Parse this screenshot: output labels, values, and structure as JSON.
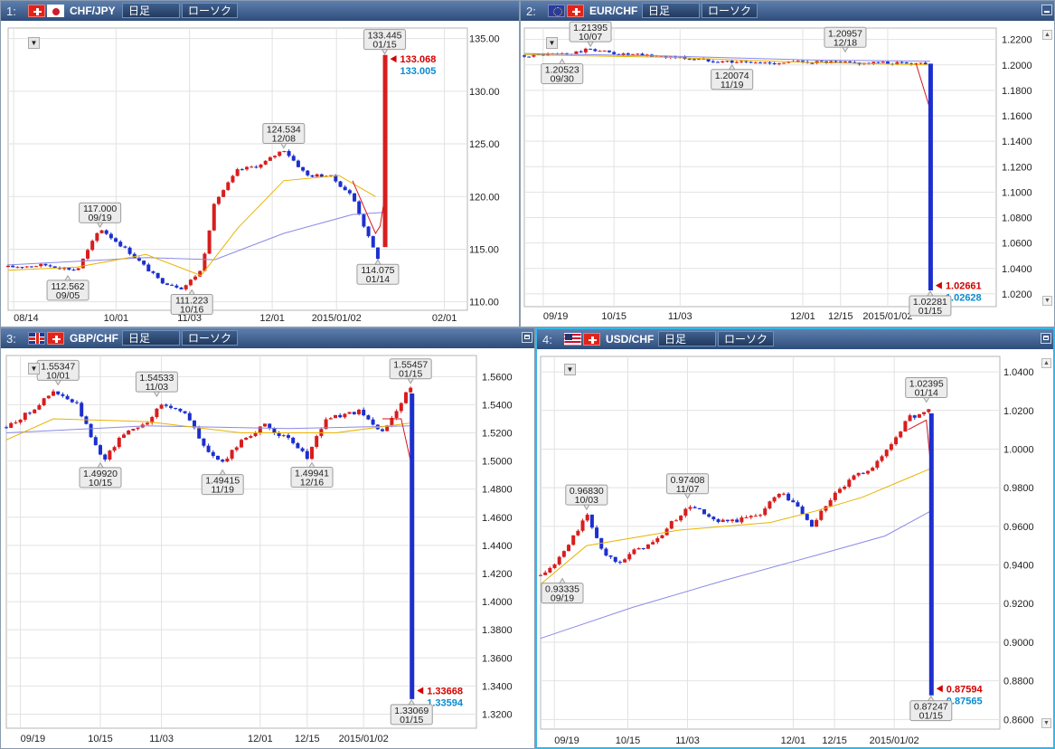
{
  "panels": [
    {
      "num": "1:",
      "symbol": "CHF/JPY",
      "flags": [
        "flag-ch",
        "flag-jp"
      ],
      "timeframe": "日足",
      "chart_style": "ローソク",
      "dropdown": "▼",
      "chart_data": {
        "type": "candlestick",
        "ylim": [
          109.2,
          136.0
        ],
        "yticks": [
          "135.00",
          "130.00",
          "125.00",
          "120.00",
          "115.00",
          "110.00"
        ],
        "ytick_values": [
          135,
          130,
          125,
          120,
          115,
          110
        ],
        "xticks": [
          "08/14",
          "10/01",
          "11/03",
          "12/01",
          "2015/01/02",
          "02/01"
        ],
        "xtick_pos": [
          0.012,
          0.235,
          0.395,
          0.575,
          0.715,
          0.95
        ],
        "last_index": 0.82,
        "anchors": [
          [
            0,
            113.3
          ],
          [
            0.08,
            113.5
          ],
          [
            0.15,
            113.0
          ],
          [
            0.2,
            117.0
          ],
          [
            0.27,
            114.5
          ],
          [
            0.33,
            112.0
          ],
          [
            0.38,
            111.3
          ],
          [
            0.42,
            113.0
          ],
          [
            0.45,
            119.5
          ],
          [
            0.5,
            122.5
          ],
          [
            0.55,
            123.0
          ],
          [
            0.6,
            124.5
          ],
          [
            0.65,
            122.0
          ],
          [
            0.7,
            122.0
          ],
          [
            0.75,
            120.0
          ],
          [
            0.79,
            115.5
          ],
          [
            0.805,
            114.2
          ]
        ],
        "spike": {
          "from": 115.2,
          "to": 133.445,
          "close": 133.068,
          "color": "#d71e1e"
        },
        "ma_short": [
          [
            0.75,
            121.5
          ],
          [
            0.79,
            117.5
          ],
          [
            0.8,
            116.5
          ],
          [
            0.81,
            117.2
          ],
          [
            0.82,
            120
          ]
        ],
        "ma_mid": [
          [
            0,
            113
          ],
          [
            0.15,
            113.3
          ],
          [
            0.3,
            114.5
          ],
          [
            0.42,
            112.5
          ],
          [
            0.5,
            117
          ],
          [
            0.6,
            121.5
          ],
          [
            0.72,
            122
          ],
          [
            0.8,
            120
          ]
        ],
        "ma_long": [
          [
            0,
            113.5
          ],
          [
            0.3,
            114.2
          ],
          [
            0.45,
            114
          ],
          [
            0.6,
            116.5
          ],
          [
            0.75,
            118.3
          ],
          [
            0.82,
            118.5
          ]
        ],
        "bid": "133.068",
        "ask": "133.005",
        "annotations": [
          {
            "value": "117.000",
            "date": "09/19",
            "x": 0.2,
            "y": 117.0,
            "pos": "above"
          },
          {
            "value": "112.562",
            "date": "09/05",
            "x": 0.13,
            "y": 112.56,
            "pos": "below"
          },
          {
            "value": "111.223",
            "date": "10/16",
            "x": 0.4,
            "y": 111.22,
            "pos": "below"
          },
          {
            "value": "124.534",
            "date": "12/08",
            "x": 0.6,
            "y": 124.53,
            "pos": "above"
          },
          {
            "value": "114.075",
            "date": "01/14",
            "x": 0.805,
            "y": 114.08,
            "pos": "below"
          },
          {
            "value": "133.445",
            "date": "01/15",
            "x": 0.82,
            "y": 133.45,
            "pos": "above"
          }
        ]
      }
    },
    {
      "num": "2:",
      "symbol": "EUR/CHF",
      "flags": [
        "flag-eu",
        "flag-ch"
      ],
      "timeframe": "日足",
      "chart_style": "ローソク",
      "dropdown": "▼",
      "chart_data": {
        "type": "candlestick",
        "ylim": [
          1.01,
          1.229
        ],
        "yticks": [
          "1.2200",
          "1.2000",
          "1.1800",
          "1.1600",
          "1.1400",
          "1.1200",
          "1.1000",
          "1.0800",
          "1.0600",
          "1.0400",
          "1.0200"
        ],
        "ytick_values": [
          1.22,
          1.2,
          1.18,
          1.16,
          1.14,
          1.12,
          1.1,
          1.08,
          1.06,
          1.04,
          1.02
        ],
        "xticks": [
          "09/19",
          "10/15",
          "11/03",
          "12/01",
          "12/15",
          "2015/01/02"
        ],
        "xtick_pos": [
          0.04,
          0.19,
          0.33,
          0.59,
          0.67,
          0.77
        ],
        "last_index": 0.86,
        "anchors": [
          [
            0,
            1.2075
          ],
          [
            0.1,
            1.209
          ],
          [
            0.14,
            1.2125
          ],
          [
            0.2,
            1.2085
          ],
          [
            0.3,
            1.2065
          ],
          [
            0.4,
            1.2035
          ],
          [
            0.5,
            1.2015
          ],
          [
            0.6,
            1.2025
          ],
          [
            0.7,
            1.2015
          ],
          [
            0.8,
            1.2015
          ],
          [
            0.85,
            1.2015
          ]
        ],
        "spike": {
          "from": 1.201,
          "to": 1.02281,
          "close": 1.02661,
          "color": "#1c2fcf"
        },
        "ma_short": [
          [
            0.83,
            1.201
          ],
          [
            0.86,
            1.165
          ]
        ],
        "ma_mid": [
          [
            0,
            1.208
          ],
          [
            0.3,
            1.206
          ],
          [
            0.6,
            1.202
          ],
          [
            0.86,
            1.2
          ]
        ],
        "ma_long": [
          [
            0,
            1.209
          ],
          [
            0.3,
            1.207
          ],
          [
            0.6,
            1.204
          ],
          [
            0.86,
            1.203
          ]
        ],
        "bid": "1.02661",
        "ask": "1.02628",
        "annotations": [
          {
            "value": "1.21395",
            "date": "10/07",
            "x": 0.14,
            "y": 1.21395,
            "pos": "above"
          },
          {
            "value": "1.20523",
            "date": "09/30",
            "x": 0.08,
            "y": 1.2052,
            "pos": "below"
          },
          {
            "value": "1.20074",
            "date": "11/19",
            "x": 0.44,
            "y": 1.2007,
            "pos": "below"
          },
          {
            "value": "1.20957",
            "date": "12/18",
            "x": 0.68,
            "y": 1.2096,
            "pos": "above"
          },
          {
            "value": "1.02281",
            "date": "01/15",
            "x": 0.86,
            "y": 1.0228,
            "pos": "below"
          }
        ]
      }
    },
    {
      "num": "3:",
      "symbol": "GBP/CHF",
      "flags": [
        "flag-gb",
        "flag-ch"
      ],
      "timeframe": "日足",
      "chart_style": "ローソク",
      "dropdown": "▼",
      "chart_data": {
        "type": "candlestick",
        "ylim": [
          1.31,
          1.575
        ],
        "yticks": [
          "1.5600",
          "1.5400",
          "1.5200",
          "1.5000",
          "1.4800",
          "1.4600",
          "1.4400",
          "1.4200",
          "1.4000",
          "1.3800",
          "1.3600",
          "1.3400",
          "1.3200"
        ],
        "ytick_values": [
          1.56,
          1.54,
          1.52,
          1.5,
          1.48,
          1.46,
          1.44,
          1.42,
          1.4,
          1.38,
          1.36,
          1.34,
          1.32
        ],
        "xticks": [
          "09/19",
          "10/15",
          "11/03",
          "12/01",
          "12/15",
          "2015/01/02"
        ],
        "xtick_pos": [
          0.03,
          0.2,
          0.33,
          0.54,
          0.64,
          0.76
        ],
        "last_index": 0.862,
        "anchors": [
          [
            0,
            1.524
          ],
          [
            0.05,
            1.535
          ],
          [
            0.1,
            1.549
          ],
          [
            0.15,
            1.54
          ],
          [
            0.19,
            1.51
          ],
          [
            0.21,
            1.502
          ],
          [
            0.25,
            1.52
          ],
          [
            0.3,
            1.528
          ],
          [
            0.33,
            1.54
          ],
          [
            0.38,
            1.535
          ],
          [
            0.42,
            1.51
          ],
          [
            0.46,
            1.498
          ],
          [
            0.5,
            1.515
          ],
          [
            0.55,
            1.525
          ],
          [
            0.6,
            1.515
          ],
          [
            0.64,
            1.503
          ],
          [
            0.68,
            1.53
          ],
          [
            0.75,
            1.535
          ],
          [
            0.8,
            1.52
          ],
          [
            0.85,
            1.548
          ],
          [
            0.86,
            1.552
          ]
        ],
        "spike": {
          "from": 1.548,
          "to": 1.33069,
          "close": 1.33668,
          "color": "#1c2fcf"
        },
        "ma_short": [
          [
            0.8,
            1.53
          ],
          [
            0.84,
            1.53
          ],
          [
            0.86,
            1.5
          ]
        ],
        "ma_mid": [
          [
            0,
            1.515
          ],
          [
            0.1,
            1.53
          ],
          [
            0.3,
            1.528
          ],
          [
            0.5,
            1.52
          ],
          [
            0.7,
            1.52
          ],
          [
            0.86,
            1.527
          ]
        ],
        "ma_long": [
          [
            0,
            1.52
          ],
          [
            0.3,
            1.525
          ],
          [
            0.6,
            1.523
          ],
          [
            0.86,
            1.525
          ]
        ],
        "bid": "1.33668",
        "ask": "1.33594",
        "annotations": [
          {
            "value": "1.55347",
            "date": "10/01",
            "x": 0.11,
            "y": 1.5535,
            "pos": "above"
          },
          {
            "value": "1.54533",
            "date": "11/03",
            "x": 0.32,
            "y": 1.5453,
            "pos": "above"
          },
          {
            "value": "1.55457",
            "date": "01/15",
            "x": 0.86,
            "y": 1.5546,
            "pos": "above"
          },
          {
            "value": "1.49920",
            "date": "10/15",
            "x": 0.2,
            "y": 1.4992,
            "pos": "below"
          },
          {
            "value": "1.49415",
            "date": "11/19",
            "x": 0.46,
            "y": 1.4942,
            "pos": "below"
          },
          {
            "value": "1.49941",
            "date": "12/16",
            "x": 0.65,
            "y": 1.4994,
            "pos": "below"
          },
          {
            "value": "1.33069",
            "date": "01/15",
            "x": 0.862,
            "y": 1.3307,
            "pos": "below"
          }
        ]
      }
    },
    {
      "num": "4:",
      "symbol": "USD/CHF",
      "flags": [
        "flag-us",
        "flag-ch"
      ],
      "timeframe": "日足",
      "chart_style": "ローソク",
      "dropdown": "▼",
      "chart_data": {
        "type": "candlestick",
        "ylim": [
          0.855,
          1.048
        ],
        "yticks": [
          "1.0400",
          "1.0200",
          "1.0000",
          "0.9800",
          "0.9600",
          "0.9400",
          "0.9200",
          "0.9000",
          "0.8800",
          "0.8600"
        ],
        "ytick_values": [
          1.04,
          1.02,
          1.0,
          0.98,
          0.96,
          0.94,
          0.92,
          0.9,
          0.88,
          0.86
        ],
        "xticks": [
          "09/19",
          "10/15",
          "11/03",
          "12/01",
          "12/15",
          "2015/01/02"
        ],
        "xtick_pos": [
          0.03,
          0.19,
          0.32,
          0.55,
          0.64,
          0.77
        ],
        "last_index": 0.85,
        "anchors": [
          [
            0,
            0.9345
          ],
          [
            0.03,
            0.94
          ],
          [
            0.06,
            0.95
          ],
          [
            0.1,
            0.966
          ],
          [
            0.14,
            0.945
          ],
          [
            0.17,
            0.942
          ],
          [
            0.21,
            0.948
          ],
          [
            0.25,
            0.952
          ],
          [
            0.29,
            0.963
          ],
          [
            0.33,
            0.971
          ],
          [
            0.38,
            0.962
          ],
          [
            0.43,
            0.963
          ],
          [
            0.48,
            0.967
          ],
          [
            0.52,
            0.978
          ],
          [
            0.56,
            0.97
          ],
          [
            0.59,
            0.96
          ],
          [
            0.63,
            0.974
          ],
          [
            0.68,
            0.985
          ],
          [
            0.73,
            0.992
          ],
          [
            0.77,
            1.005
          ],
          [
            0.8,
            1.016
          ],
          [
            0.84,
            1.0195
          ],
          [
            0.845,
            1.02
          ]
        ],
        "spike": {
          "from": 1.0185,
          "to": 0.87247,
          "close": 0.87594,
          "color": "#1c2fcf"
        },
        "ma_short": [
          [
            0.8,
            1.01
          ],
          [
            0.84,
            1.015
          ],
          [
            0.85,
            0.99
          ]
        ],
        "ma_mid": [
          [
            0,
            0.93
          ],
          [
            0.1,
            0.95
          ],
          [
            0.3,
            0.958
          ],
          [
            0.5,
            0.962
          ],
          [
            0.6,
            0.968
          ],
          [
            0.7,
            0.975
          ],
          [
            0.8,
            0.985
          ],
          [
            0.85,
            0.99
          ]
        ],
        "ma_long": [
          [
            0,
            0.902
          ],
          [
            0.2,
            0.918
          ],
          [
            0.4,
            0.932
          ],
          [
            0.6,
            0.945
          ],
          [
            0.75,
            0.955
          ],
          [
            0.85,
            0.968
          ]
        ],
        "bid": "0.87594",
        "ask": "0.87565",
        "annotations": [
          {
            "value": "0.96830",
            "date": "10/03",
            "x": 0.1,
            "y": 0.9683,
            "pos": "above"
          },
          {
            "value": "0.97408",
            "date": "11/07",
            "x": 0.32,
            "y": 0.9741,
            "pos": "above"
          },
          {
            "value": "1.02395",
            "date": "01/14",
            "x": 0.84,
            "y": 1.0239,
            "pos": "above"
          },
          {
            "value": "0.93335",
            "date": "09/19",
            "x": 0.005,
            "y": 0.9334,
            "pos": "below"
          },
          {
            "value": "0.87247",
            "date": "01/15",
            "x": 0.85,
            "y": 0.8725,
            "pos": "below"
          }
        ]
      }
    }
  ],
  "colors": {
    "up": "#d71e1e",
    "down": "#1c2fcf",
    "ma_short": "#d4141c",
    "ma_mid": "#e8b400",
    "ma_long": "#8a8ae6",
    "bid": "#d40000",
    "ask": "#0a8bd0",
    "grid": "#e2e2e2"
  }
}
